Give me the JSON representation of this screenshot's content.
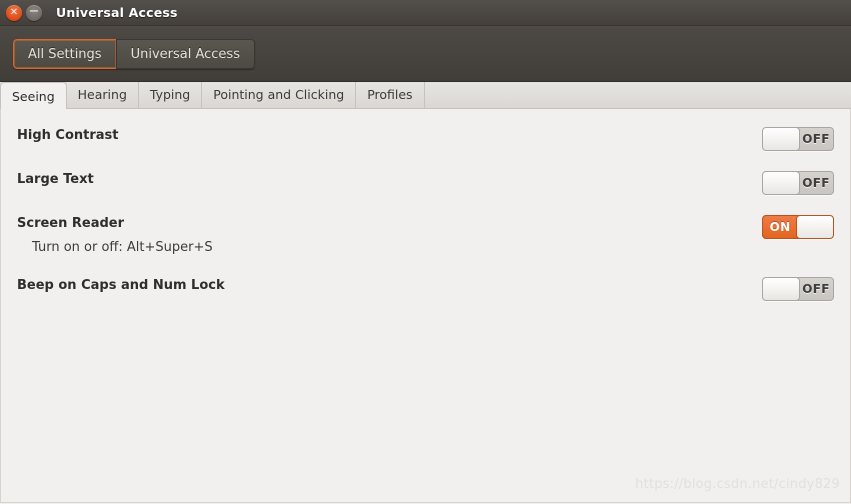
{
  "window": {
    "title": "Universal Access",
    "controls": [
      {
        "name": "close-button",
        "glyph": "✕"
      },
      {
        "name": "minimize-button",
        "glyph": "−"
      }
    ]
  },
  "toolbar": {
    "buttons": [
      {
        "label": "All Settings",
        "focused": true
      },
      {
        "label": "Universal Access",
        "focused": false
      }
    ]
  },
  "tabs": [
    {
      "label": "Seeing",
      "active": true
    },
    {
      "label": "Hearing",
      "active": false
    },
    {
      "label": "Typing",
      "active": false
    },
    {
      "label": "Pointing and Clicking",
      "active": false
    },
    {
      "label": "Profiles",
      "active": false
    }
  ],
  "settings": [
    {
      "name": "high-contrast",
      "title": "High Contrast",
      "subtitle": "",
      "switch": {
        "state": "off",
        "label": "OFF"
      }
    },
    {
      "name": "large-text",
      "title": "Large Text",
      "subtitle": "",
      "switch": {
        "state": "off",
        "label": "OFF"
      }
    },
    {
      "name": "screen-reader",
      "title": "Screen Reader",
      "subtitle": "Turn on or off:  Alt+Super+S",
      "switch": {
        "state": "on",
        "label": "ON"
      }
    },
    {
      "name": "beep-on-caps-and-num-lock",
      "title": "Beep on Caps and Num Lock",
      "subtitle": "",
      "switch": {
        "state": "off",
        "label": "OFF"
      }
    }
  ],
  "watermark": "https://blog.csdn.net/cindy829",
  "colors": {
    "titlebar": "#4a4742",
    "toolbar": "#474440",
    "content_bg": "#f1f0ee",
    "accent_orange": "#e3651f",
    "close_button": "#dd4814",
    "focus_border": "#d4682e"
  }
}
